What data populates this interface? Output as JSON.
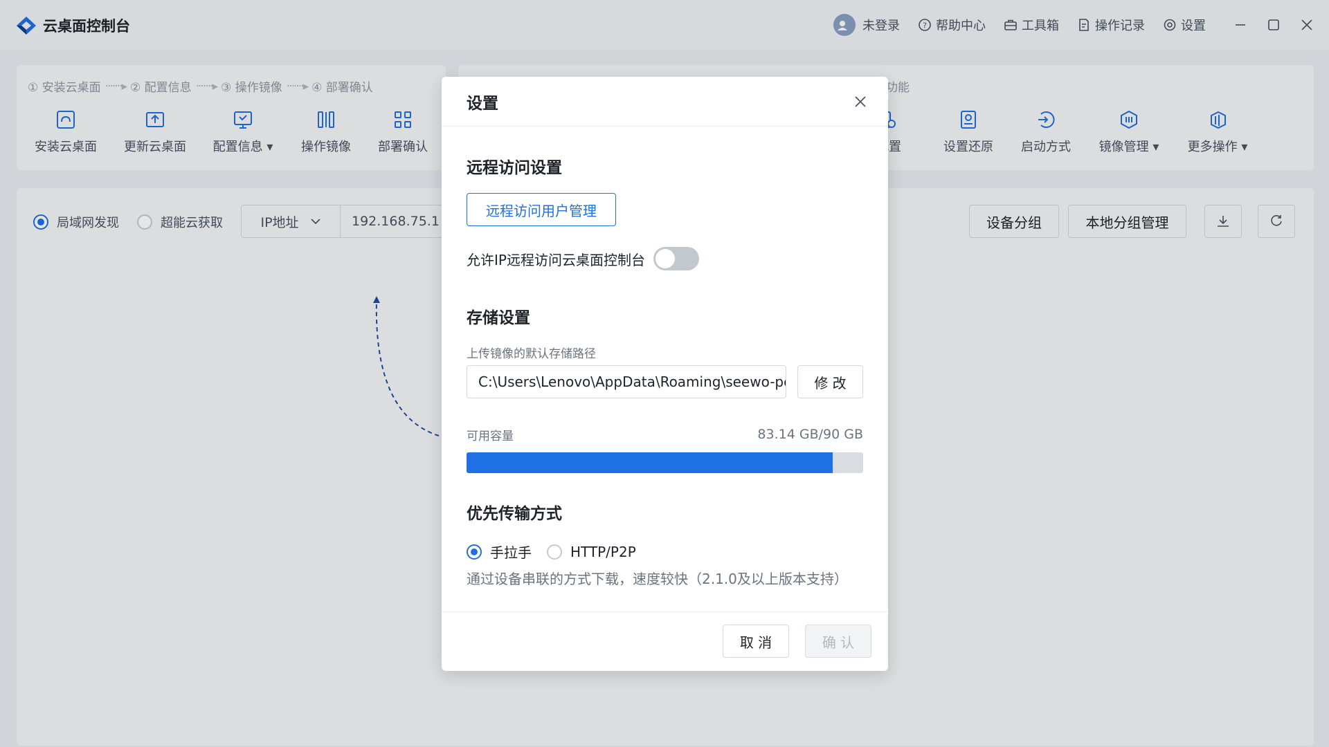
{
  "app": {
    "title": "云桌面控制台"
  },
  "titlebar": {
    "login": "未登录",
    "help": "帮助中心",
    "toolbox": "工具箱",
    "records": "操作记录",
    "settings": "设置"
  },
  "steps": [
    "① 安装云桌面",
    "② 配置信息",
    "③ 操作镜像",
    "④ 部署确认"
  ],
  "tools_left": [
    {
      "label": "安装云桌面",
      "icon": "install-icon"
    },
    {
      "label": "更新云桌面",
      "icon": "upload-icon"
    },
    {
      "label": "配置信息 ▾",
      "icon": "config-icon"
    },
    {
      "label": "操作镜像",
      "icon": "mirror-icon"
    },
    {
      "label": "部署确认",
      "icon": "deploy-icon"
    }
  ],
  "right_section_label": "功能",
  "tools_right": [
    {
      "label": "配置",
      "icon": "device-config-icon"
    },
    {
      "label": "设置还原",
      "icon": "restore-icon"
    },
    {
      "label": "启动方式",
      "icon": "boot-icon"
    },
    {
      "label": "镜像管理 ▾",
      "icon": "image-manage-icon"
    },
    {
      "label": "更多操作 ▾",
      "icon": "more-icon"
    }
  ],
  "discovery": {
    "lan": "局域网发现",
    "cloud": "超能云获取",
    "select": "IP地址",
    "ip_value": "192.168.75.1"
  },
  "main_buttons": {
    "group": "设备分组",
    "local_group": "本地分组管理"
  },
  "dialog": {
    "title": "设置",
    "remote_title": "远程访问设置",
    "remote_user_btn": "远程访问用户管理",
    "allow_ip_label": "允许IP远程访问云桌面控制台",
    "allow_ip_enabled": false,
    "storage_title": "存储设置",
    "path_label": "上传镜像的默认存储路径",
    "path_value": "C:\\Users\\Lenovo\\AppData\\Roaming\\seewo-pc",
    "modify_btn": "修 改",
    "capacity_label": "可用容量",
    "capacity_value": "83.14 GB/90 GB",
    "capacity_fraction": 0.924,
    "transfer_title": "优先传输方式",
    "transfer_options": [
      "手拉手",
      "HTTP/P2P"
    ],
    "transfer_selected": "手拉手",
    "transfer_hint": "通过设备串联的方式下载，速度较快（2.1.0及以上版本支持）",
    "cancel_btn": "取 消",
    "confirm_btn": "确 认"
  },
  "colors": {
    "accent": "#1f6fe5",
    "disabled": "#b3b8c0"
  }
}
